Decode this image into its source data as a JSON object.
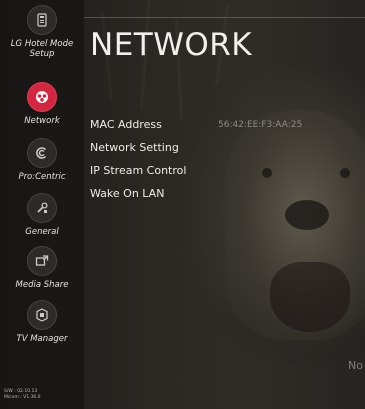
{
  "sidebar": {
    "items": [
      {
        "label": "LG Hotel Mode Setup",
        "icon": "phone-icon",
        "active": false
      },
      {
        "label": "Network",
        "icon": "network-icon",
        "active": true
      },
      {
        "label": "Pro:Centric",
        "icon": "procentric-icon",
        "active": false
      },
      {
        "label": "General",
        "icon": "settings-tool-icon",
        "active": false
      },
      {
        "label": "Media Share",
        "icon": "media-share-icon",
        "active": false
      },
      {
        "label": "TV Manager",
        "icon": "tv-manager-icon",
        "active": false
      }
    ]
  },
  "version": {
    "sw": "S/W : 02.10.13",
    "micom": "Micom : V1.36.0"
  },
  "main": {
    "title": "NETWORK",
    "menu": [
      {
        "label": "MAC Address",
        "value": "56:42:EE:F3:AA:25"
      },
      {
        "label": "Network Setting",
        "value": ""
      },
      {
        "label": "IP Stream Control",
        "value": ""
      },
      {
        "label": "Wake On LAN",
        "value": ""
      }
    ],
    "corner_text": "No"
  },
  "colors": {
    "accent": "#d4263f",
    "sidebar_bg": "#161513",
    "text": "#efece7"
  }
}
